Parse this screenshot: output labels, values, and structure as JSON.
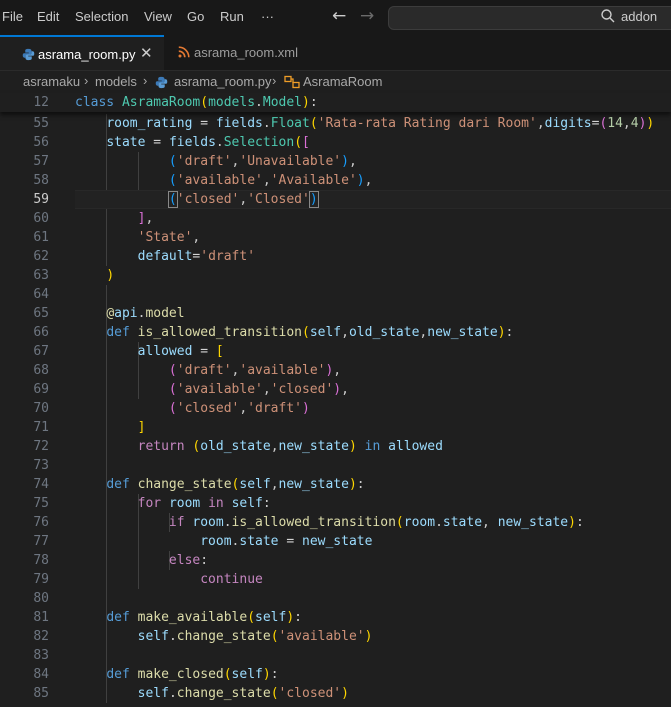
{
  "menubar": {
    "items": [
      "File",
      "Edit",
      "Selection",
      "View",
      "Go",
      "Run",
      "···"
    ],
    "search_text": "addon"
  },
  "tabs": [
    {
      "label": "asrama_room.py",
      "icon": "python-file-icon",
      "active": true
    },
    {
      "label": "asrama_room.xml",
      "icon": "rss-file-icon",
      "active": false
    }
  ],
  "breadcrumb": [
    "asramaku",
    "models",
    "asrama_room.py",
    "AsramaRoom"
  ],
  "sticky_line": {
    "number": "12",
    "tokens": [
      [
        "kw",
        "class "
      ],
      [
        "cls",
        "AsramaRoom"
      ],
      [
        "b1",
        "("
      ],
      [
        "cls",
        "models"
      ],
      [
        "pl",
        "."
      ],
      [
        "cls",
        "Model"
      ],
      [
        "b1",
        ")"
      ],
      [
        "pl",
        ":"
      ]
    ]
  },
  "code_lines": [
    {
      "n": "55",
      "t": [
        [
          "pl",
          "    "
        ],
        [
          "var",
          "room_rating"
        ],
        [
          "op",
          " = "
        ],
        [
          "var",
          "fields"
        ],
        [
          "pl",
          "."
        ],
        [
          "cls",
          "Float"
        ],
        [
          "b1",
          "("
        ],
        [
          "str",
          "'Rata-rata Rating dari Room'"
        ],
        [
          "pl",
          ","
        ],
        [
          "var",
          "digits"
        ],
        [
          "op",
          "="
        ],
        [
          "b2",
          "("
        ],
        [
          "num",
          "14"
        ],
        [
          "pl",
          ","
        ],
        [
          "num",
          "4"
        ],
        [
          "b2",
          ")"
        ],
        [
          "b1",
          ")"
        ]
      ]
    },
    {
      "n": "56",
      "t": [
        [
          "pl",
          "    "
        ],
        [
          "var",
          "state"
        ],
        [
          "op",
          " = "
        ],
        [
          "var",
          "fields"
        ],
        [
          "pl",
          "."
        ],
        [
          "cls",
          "Selection"
        ],
        [
          "b1",
          "("
        ],
        [
          "b2",
          "["
        ]
      ]
    },
    {
      "n": "57",
      "t": [
        [
          "pl",
          "            "
        ],
        [
          "b3",
          "("
        ],
        [
          "str",
          "'draft'"
        ],
        [
          "pl",
          ","
        ],
        [
          "str",
          "'Unavailable'"
        ],
        [
          "b3",
          ")"
        ],
        [
          "pl",
          ","
        ]
      ]
    },
    {
      "n": "58",
      "t": [
        [
          "pl",
          "            "
        ],
        [
          "b3",
          "("
        ],
        [
          "str",
          "'available'"
        ],
        [
          "pl",
          ","
        ],
        [
          "str",
          "'Available'"
        ],
        [
          "b3",
          ")"
        ],
        [
          "pl",
          ","
        ]
      ]
    },
    {
      "n": "59",
      "t": [
        [
          "pl",
          "            "
        ],
        [
          "b3 bm",
          "("
        ],
        [
          "str",
          "'closed'"
        ],
        [
          "pl",
          ","
        ],
        [
          "str",
          "'Closed'"
        ],
        [
          "b3 bm",
          ")"
        ]
      ],
      "current": true
    },
    {
      "n": "60",
      "t": [
        [
          "pl",
          "        "
        ],
        [
          "b2",
          "]"
        ],
        [
          "pl",
          ","
        ]
      ]
    },
    {
      "n": "61",
      "t": [
        [
          "pl",
          "        "
        ],
        [
          "str",
          "'State'"
        ],
        [
          "pl",
          ","
        ]
      ]
    },
    {
      "n": "62",
      "t": [
        [
          "pl",
          "        "
        ],
        [
          "var",
          "default"
        ],
        [
          "op",
          "="
        ],
        [
          "str",
          "'draft'"
        ]
      ]
    },
    {
      "n": "63",
      "t": [
        [
          "pl",
          "    "
        ],
        [
          "b1",
          ")"
        ]
      ]
    },
    {
      "n": "64",
      "t": []
    },
    {
      "n": "65",
      "t": [
        [
          "pl",
          "    "
        ],
        [
          "fn",
          "@"
        ],
        [
          "var",
          "api"
        ],
        [
          "pl",
          "."
        ],
        [
          "fn",
          "model"
        ]
      ]
    },
    {
      "n": "66",
      "t": [
        [
          "pl",
          "    "
        ],
        [
          "kw",
          "def "
        ],
        [
          "fn",
          "is_allowed_transition"
        ],
        [
          "b1",
          "("
        ],
        [
          "var",
          "self"
        ],
        [
          "pl",
          ","
        ],
        [
          "var",
          "old_state"
        ],
        [
          "pl",
          ","
        ],
        [
          "var",
          "new_state"
        ],
        [
          "b1",
          ")"
        ],
        [
          "pl",
          ":"
        ]
      ]
    },
    {
      "n": "67",
      "t": [
        [
          "pl",
          "        "
        ],
        [
          "var",
          "allowed"
        ],
        [
          "op",
          " = "
        ],
        [
          "b1",
          "["
        ]
      ]
    },
    {
      "n": "68",
      "t": [
        [
          "pl",
          "            "
        ],
        [
          "b2",
          "("
        ],
        [
          "str",
          "'draft'"
        ],
        [
          "pl",
          ","
        ],
        [
          "str",
          "'available'"
        ],
        [
          "b2",
          ")"
        ],
        [
          "pl",
          ","
        ]
      ]
    },
    {
      "n": "69",
      "t": [
        [
          "pl",
          "            "
        ],
        [
          "b2",
          "("
        ],
        [
          "str",
          "'available'"
        ],
        [
          "pl",
          ","
        ],
        [
          "str",
          "'closed'"
        ],
        [
          "b2",
          ")"
        ],
        [
          "pl",
          ","
        ]
      ]
    },
    {
      "n": "70",
      "t": [
        [
          "pl",
          "            "
        ],
        [
          "b2",
          "("
        ],
        [
          "str",
          "'closed'"
        ],
        [
          "pl",
          ","
        ],
        [
          "str",
          "'draft'"
        ],
        [
          "b2",
          ")"
        ]
      ]
    },
    {
      "n": "71",
      "t": [
        [
          "pl",
          "        "
        ],
        [
          "b1",
          "]"
        ]
      ]
    },
    {
      "n": "72",
      "t": [
        [
          "pl",
          "        "
        ],
        [
          "ctl",
          "return "
        ],
        [
          "b1",
          "("
        ],
        [
          "var",
          "old_state"
        ],
        [
          "pl",
          ","
        ],
        [
          "var",
          "new_state"
        ],
        [
          "b1",
          ")"
        ],
        [
          "kw",
          " in "
        ],
        [
          "var",
          "allowed"
        ]
      ]
    },
    {
      "n": "73",
      "t": []
    },
    {
      "n": "74",
      "t": [
        [
          "pl",
          "    "
        ],
        [
          "kw",
          "def "
        ],
        [
          "fn",
          "change_state"
        ],
        [
          "b1",
          "("
        ],
        [
          "var",
          "self"
        ],
        [
          "pl",
          ","
        ],
        [
          "var",
          "new_state"
        ],
        [
          "b1",
          ")"
        ],
        [
          "pl",
          ":"
        ]
      ]
    },
    {
      "n": "75",
      "t": [
        [
          "pl",
          "        "
        ],
        [
          "ctl",
          "for "
        ],
        [
          "var",
          "room"
        ],
        [
          "ctl",
          " in "
        ],
        [
          "var",
          "self"
        ],
        [
          "pl",
          ":"
        ]
      ]
    },
    {
      "n": "76",
      "t": [
        [
          "pl",
          "            "
        ],
        [
          "ctl",
          "if "
        ],
        [
          "var",
          "room"
        ],
        [
          "pl",
          "."
        ],
        [
          "fn",
          "is_allowed_transition"
        ],
        [
          "b1",
          "("
        ],
        [
          "var",
          "room"
        ],
        [
          "pl",
          "."
        ],
        [
          "var",
          "state"
        ],
        [
          "pl",
          ", "
        ],
        [
          "var",
          "new_state"
        ],
        [
          "b1",
          ")"
        ],
        [
          "pl",
          ":"
        ]
      ]
    },
    {
      "n": "77",
      "t": [
        [
          "pl",
          "                "
        ],
        [
          "var",
          "room"
        ],
        [
          "pl",
          "."
        ],
        [
          "var",
          "state"
        ],
        [
          "op",
          " = "
        ],
        [
          "var",
          "new_state"
        ]
      ]
    },
    {
      "n": "78",
      "t": [
        [
          "pl",
          "            "
        ],
        [
          "ctl",
          "else"
        ],
        [
          "pl",
          ":"
        ]
      ]
    },
    {
      "n": "79",
      "t": [
        [
          "pl",
          "                "
        ],
        [
          "ctl",
          "continue"
        ]
      ]
    },
    {
      "n": "80",
      "t": []
    },
    {
      "n": "81",
      "t": [
        [
          "pl",
          "    "
        ],
        [
          "kw",
          "def "
        ],
        [
          "fn",
          "make_available"
        ],
        [
          "b1",
          "("
        ],
        [
          "var",
          "self"
        ],
        [
          "b1",
          ")"
        ],
        [
          "pl",
          ":"
        ]
      ]
    },
    {
      "n": "82",
      "t": [
        [
          "pl",
          "        "
        ],
        [
          "var",
          "self"
        ],
        [
          "pl",
          "."
        ],
        [
          "fn",
          "change_state"
        ],
        [
          "b1",
          "("
        ],
        [
          "str",
          "'available'"
        ],
        [
          "b1",
          ")"
        ]
      ]
    },
    {
      "n": "83",
      "t": []
    },
    {
      "n": "84",
      "t": [
        [
          "pl",
          "    "
        ],
        [
          "kw",
          "def "
        ],
        [
          "fn",
          "make_closed"
        ],
        [
          "b1",
          "("
        ],
        [
          "var",
          "self"
        ],
        [
          "b1",
          ")"
        ],
        [
          "pl",
          ":"
        ]
      ]
    },
    {
      "n": "85",
      "t": [
        [
          "pl",
          "        "
        ],
        [
          "var",
          "self"
        ],
        [
          "pl",
          "."
        ],
        [
          "fn",
          "change_state"
        ],
        [
          "b1",
          "("
        ],
        [
          "str",
          "'closed'"
        ],
        [
          "b1",
          ")"
        ]
      ]
    }
  ]
}
